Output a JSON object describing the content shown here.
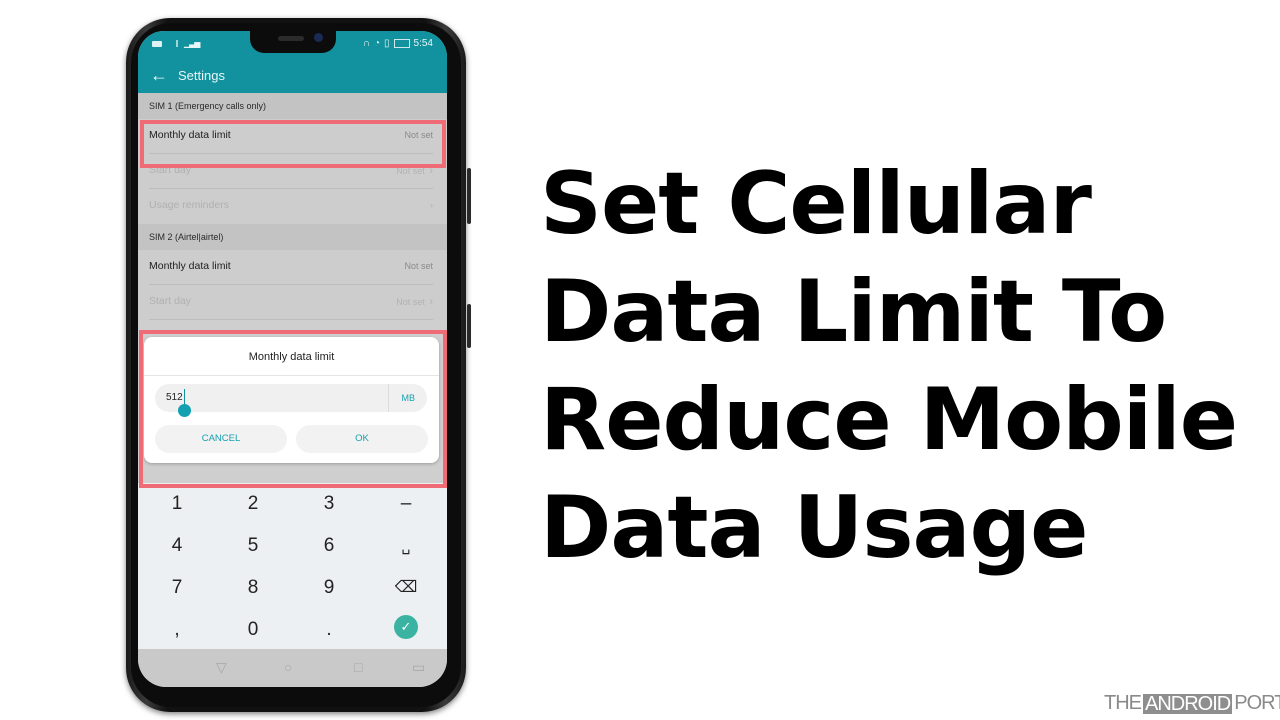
{
  "statusbar": {
    "left_icons": [
      "sim-icon",
      "signal-weak-icon",
      "signal-icon"
    ],
    "right_icons": [
      "headset-icon",
      "sync-icon",
      "vibrate-icon",
      "battery-icon"
    ],
    "time": "5:54"
  },
  "appbar": {
    "back_icon": "←",
    "title": "Settings"
  },
  "sim1": {
    "header": "SIM 1 (Emergency calls only)",
    "rows": [
      {
        "label": "Monthly data limit",
        "value": "Not set",
        "chevron": ""
      },
      {
        "label": "Start day",
        "value": "Not set",
        "chevron": "›"
      },
      {
        "label": "Usage reminders",
        "value": "",
        "chevron": "›"
      }
    ]
  },
  "sim2": {
    "header": "SIM 2 (Airtel|airtel)",
    "rows": [
      {
        "label": "Monthly data limit",
        "value": "Not set",
        "chevron": ""
      },
      {
        "label": "Start day",
        "value": "Not set",
        "chevron": "›"
      }
    ]
  },
  "dialog": {
    "title": "Monthly data limit",
    "input_value": "512",
    "unit": "MB",
    "cancel_label": "CANCEL",
    "ok_label": "OK"
  },
  "keypad": {
    "keys": [
      "1",
      "2",
      "3",
      "–",
      "4",
      "5",
      "6",
      "␣",
      "7",
      "8",
      "9",
      "⌫",
      ",",
      "0",
      ".",
      "✓"
    ]
  },
  "navbar": {
    "icons": [
      "▽",
      "○",
      "□",
      "▭"
    ]
  },
  "headline": {
    "lines": [
      "Set Cellular",
      "Data Limit To",
      "Reduce Mobile",
      "Data Usage"
    ]
  },
  "brand": {
    "left": "THE",
    "middle": "ANDROID",
    "right": "PORTAL"
  },
  "colors": {
    "accent": "#11929e",
    "highlight": "#ef6c76",
    "ok_key": "#3bb3a2"
  }
}
